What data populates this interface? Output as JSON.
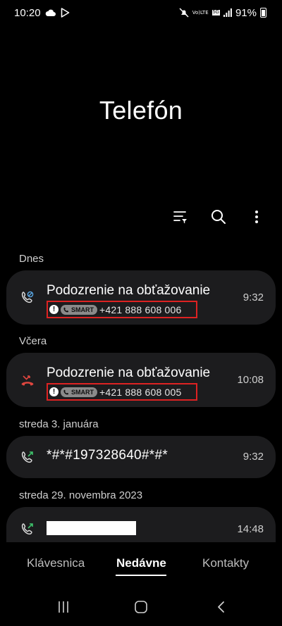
{
  "status_bar": {
    "time": "10:20",
    "battery": "91%",
    "network_badge": "5G",
    "lte_lines": [
      "Vo)",
      "LTE"
    ]
  },
  "app": {
    "title": "Telefón"
  },
  "sections": {
    "today": "Dnes",
    "yesterday": "Včera",
    "jan3": "streda 3. januára",
    "nov29": "streda 29. novembra 2023"
  },
  "calls": [
    {
      "name": "Podozrenie na obťažovanie",
      "badge": "SMART",
      "number": "+421 888 608 006",
      "time": "9:32",
      "type": "incoming-blocked"
    },
    {
      "name": "Podozrenie na obťažovanie",
      "badge": "SMART",
      "number": "+421 888 608 005",
      "time": "10:08",
      "type": "missed"
    },
    {
      "number": "*#*#197328640#*#*",
      "time": "9:32",
      "type": "outgoing"
    },
    {
      "time": "14:48",
      "type": "outgoing",
      "redacted": true
    }
  ],
  "tabs": [
    {
      "label": "Klávesnica",
      "active": false
    },
    {
      "label": "Nedávne",
      "active": true
    },
    {
      "label": "Kontakty",
      "active": false
    }
  ],
  "colors": {
    "card_bg": "#1c1c1e",
    "missed_red": "#e0463f",
    "outgoing_green": "#3ec26b",
    "highlight_box": "#dd2222"
  }
}
